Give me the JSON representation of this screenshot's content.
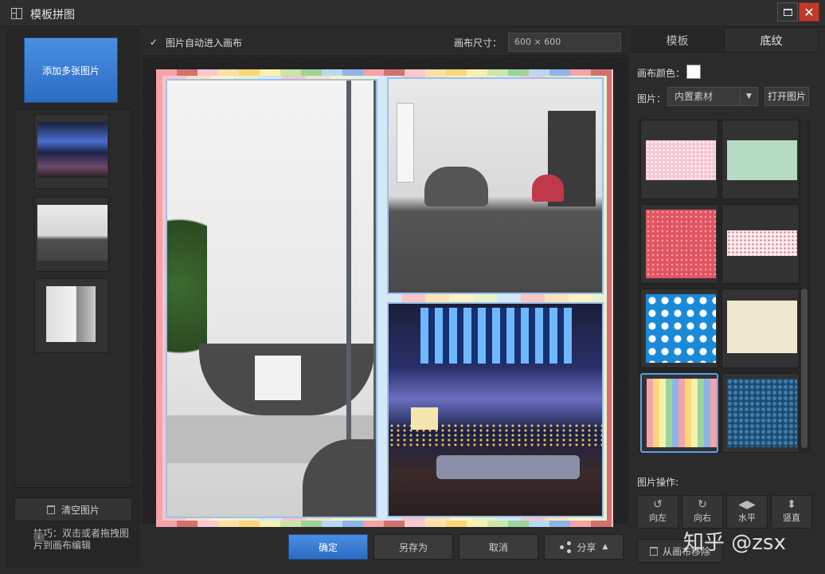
{
  "window": {
    "title": "模板拼图"
  },
  "left_panel": {
    "add_button": "添加多张图片",
    "thumbnails": [
      "night-terrace",
      "grey-living-room",
      "bathtub-room"
    ],
    "clear_button": "清空图片",
    "tip": "技巧：双击或者拖拽图片到画布编辑"
  },
  "toolbar": {
    "auto_enter_label": "图片自动进入画布",
    "auto_enter_checked": true,
    "canvas_size_label": "画布尺寸：",
    "canvas_size_value": "600 × 600"
  },
  "canvas": {
    "photos": [
      "bathtub-room",
      "grey-living-room",
      "night-terrace"
    ]
  },
  "actions": {
    "ok": "确定",
    "save_as": "另存为",
    "cancel": "取消",
    "share": "分享"
  },
  "right_panel": {
    "tabs": [
      "模板",
      "底纹"
    ],
    "active_tab": "底纹",
    "canvas_color_label": "画布颜色：",
    "canvas_color": "#ffffff",
    "image_label": "图片：",
    "image_source": "内置素材",
    "open_image_button": "打开图片",
    "textures": [
      {
        "name": "pink-dots",
        "color": "#f7c6d2"
      },
      {
        "name": "mint",
        "color": "#b5dcc3"
      },
      {
        "name": "red-dots",
        "color": "#e05561"
      },
      {
        "name": "white-pink-dots",
        "color": "#fbeef0"
      },
      {
        "name": "blue-white-dots",
        "color": "#1a8ad8"
      },
      {
        "name": "cream-lace",
        "color": "#efe7cf"
      },
      {
        "name": "pastel-stripes",
        "color": "#f4d39a",
        "selected": true
      },
      {
        "name": "blue-pattern",
        "color": "#1d4a6e"
      }
    ],
    "image_ops_label": "图片操作:",
    "ops": [
      "向左",
      "向右",
      "水平",
      "竖直"
    ],
    "remove_button": "从画布移除"
  },
  "watermark": "知乎 @zsx",
  "accent_color": "#2b6cc4"
}
